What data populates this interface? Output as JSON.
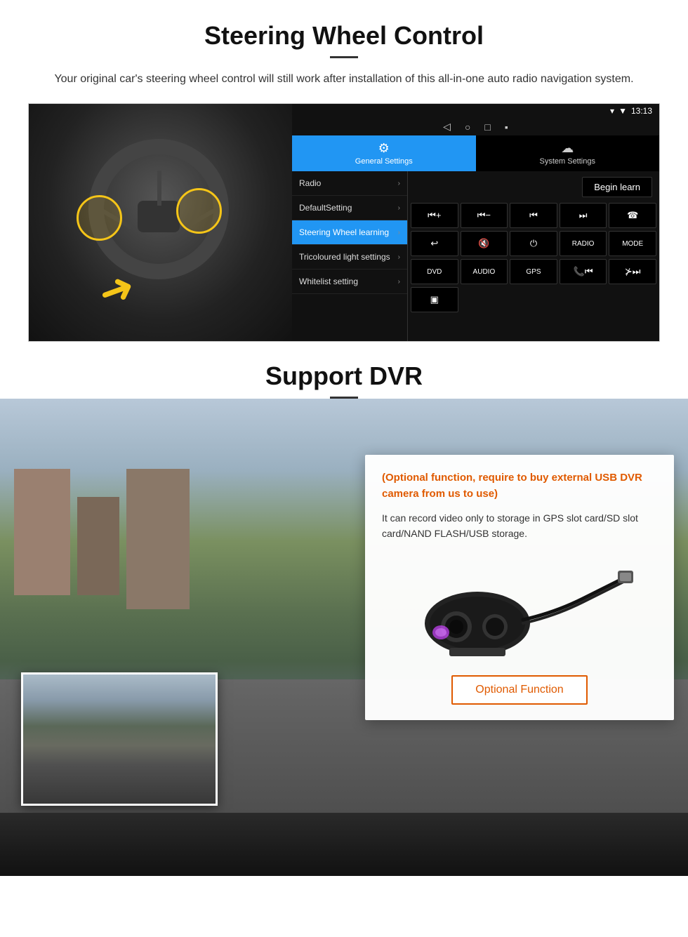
{
  "steering": {
    "title": "Steering Wheel Control",
    "subtitle": "Your original car's steering wheel control will still work after installation of this all-in-one auto radio navigation system.",
    "statusbar": {
      "time": "13:13",
      "signal": "▼",
      "wifi": "▾"
    },
    "nav_buttons": [
      "◁",
      "○",
      "□",
      "▪"
    ],
    "tabs": [
      {
        "icon": "⚙",
        "label": "General Settings",
        "active": true
      },
      {
        "icon": "☁",
        "label": "System Settings",
        "active": false
      }
    ],
    "menu_items": [
      {
        "label": "Radio",
        "active": false
      },
      {
        "label": "DefaultSetting",
        "active": false
      },
      {
        "label": "Steering Wheel learning",
        "active": true
      },
      {
        "label": "Tricoloured light settings",
        "active": false
      },
      {
        "label": "Whitelist setting",
        "active": false
      }
    ],
    "begin_learn": "Begin learn",
    "controls_row1": [
      "↦+",
      "↤−",
      "⏮",
      "⏭",
      "☎"
    ],
    "controls_row2": [
      "↩",
      "⊠×",
      "⏻",
      "RADIO",
      "MODE"
    ],
    "controls_row3": [
      "DVD",
      "AUDIO",
      "GPS",
      "📞⏮",
      "⊁⏭"
    ],
    "controls_row4": [
      "▣"
    ]
  },
  "dvr": {
    "title": "Support DVR",
    "optional_heading": "(Optional function, require to buy external USB DVR camera from us to use)",
    "description": "It can record video only to storage in GPS slot card/SD slot card/NAND FLASH/USB storage.",
    "optional_btn": "Optional Function"
  }
}
